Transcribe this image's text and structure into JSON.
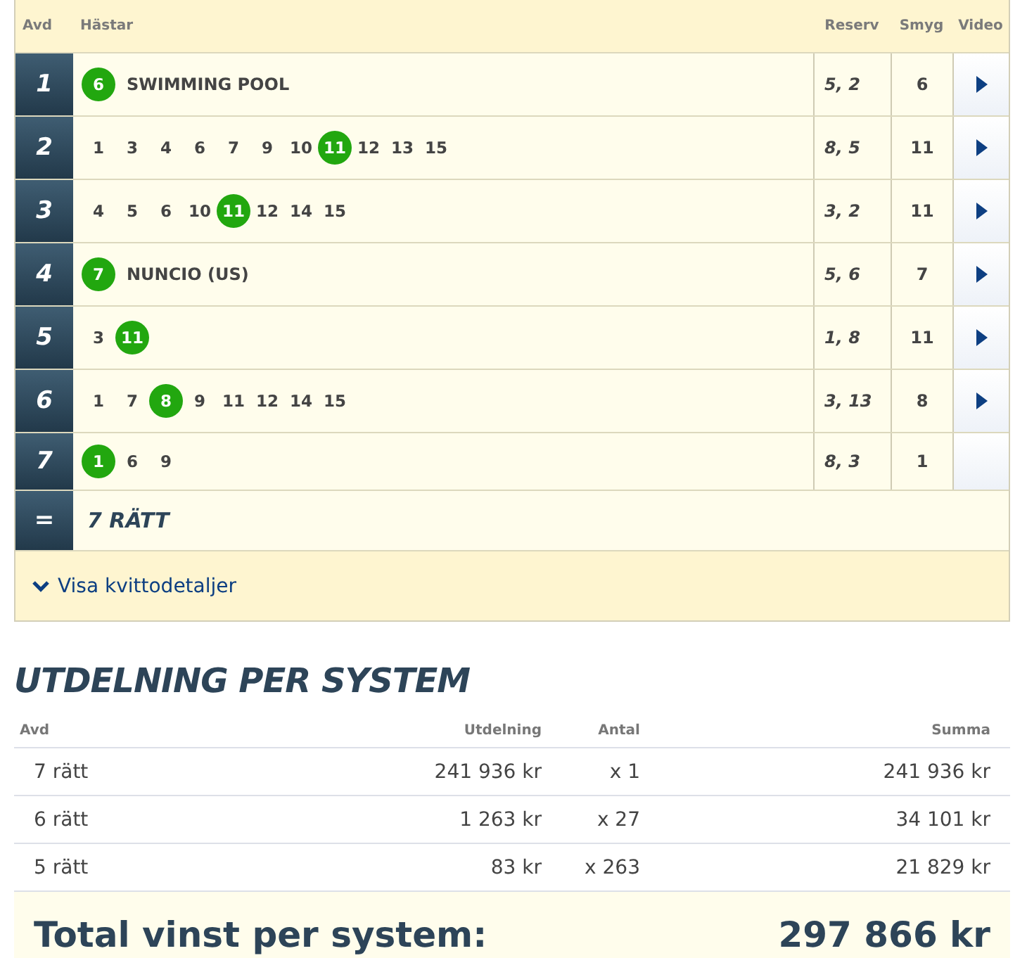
{
  "coupon": {
    "columns": [
      "Avd",
      "Hästar",
      "Reserv",
      "Smyg",
      "Video"
    ],
    "rows": [
      {
        "avd": "1",
        "horses": [
          {
            "number": "6",
            "winner": true
          }
        ],
        "name": "SWIMMING POOL",
        "reserv": "5, 2",
        "smyg": "6",
        "video": true
      },
      {
        "avd": "2",
        "horses": [
          {
            "number": "1",
            "winner": false
          },
          {
            "number": "3",
            "winner": false
          },
          {
            "number": "4",
            "winner": false
          },
          {
            "number": "6",
            "winner": false
          },
          {
            "number": "7",
            "winner": false
          },
          {
            "number": "9",
            "winner": false
          },
          {
            "number": "10",
            "winner": false
          },
          {
            "number": "11",
            "winner": true
          },
          {
            "number": "12",
            "winner": false
          },
          {
            "number": "13",
            "winner": false
          },
          {
            "number": "15",
            "winner": false
          }
        ],
        "reserv": "8, 5",
        "smyg": "11",
        "video": true
      },
      {
        "avd": "3",
        "horses": [
          {
            "number": "4",
            "winner": false
          },
          {
            "number": "5",
            "winner": false
          },
          {
            "number": "6",
            "winner": false
          },
          {
            "number": "10",
            "winner": false
          },
          {
            "number": "11",
            "winner": true
          },
          {
            "number": "12",
            "winner": false
          },
          {
            "number": "14",
            "winner": false
          },
          {
            "number": "15",
            "winner": false
          }
        ],
        "reserv": "3, 2",
        "smyg": "11",
        "video": true
      },
      {
        "avd": "4",
        "horses": [
          {
            "number": "7",
            "winner": true
          }
        ],
        "name": "NUNCIO (US)",
        "reserv": "5, 6",
        "smyg": "7",
        "video": true
      },
      {
        "avd": "5",
        "horses": [
          {
            "number": "3",
            "winner": false
          },
          {
            "number": "11",
            "winner": true
          }
        ],
        "reserv": "1, 8",
        "smyg": "11",
        "video": true
      },
      {
        "avd": "6",
        "horses": [
          {
            "number": "1",
            "winner": false
          },
          {
            "number": "7",
            "winner": false
          },
          {
            "number": "8",
            "winner": true
          },
          {
            "number": "9",
            "winner": false
          },
          {
            "number": "11",
            "winner": false
          },
          {
            "number": "12",
            "winner": false
          },
          {
            "number": "14",
            "winner": false
          },
          {
            "number": "15",
            "winner": false
          }
        ],
        "reserv": "3, 13",
        "smyg": "8",
        "video": true
      },
      {
        "avd": "7",
        "horses": [
          {
            "number": "1",
            "winner": true
          },
          {
            "number": "6",
            "winner": false
          },
          {
            "number": "9",
            "winner": false
          }
        ],
        "reserv": "8, 3",
        "smyg": "1",
        "video": false
      }
    ],
    "result": {
      "symbol": "=",
      "text": "7 RÄTT"
    },
    "details_link": "Visa kvittodetaljer"
  },
  "payout": {
    "title": "UTDELNING PER SYSTEM",
    "columns": [
      "Avd",
      "Utdelning",
      "Antal",
      "Summa"
    ],
    "rows": [
      {
        "avd": "7 rätt",
        "utdelning": "241 936 kr",
        "antal": "x 1",
        "summa": "241 936 kr"
      },
      {
        "avd": "6 rätt",
        "utdelning": "1 263 kr",
        "antal": "x 27",
        "summa": "34 101 kr"
      },
      {
        "avd": "5 rätt",
        "utdelning": "83 kr",
        "antal": "x 263",
        "summa": "21 829 kr"
      }
    ],
    "total_label": "Total vinst per system:",
    "total_value": "297 866 kr"
  }
}
